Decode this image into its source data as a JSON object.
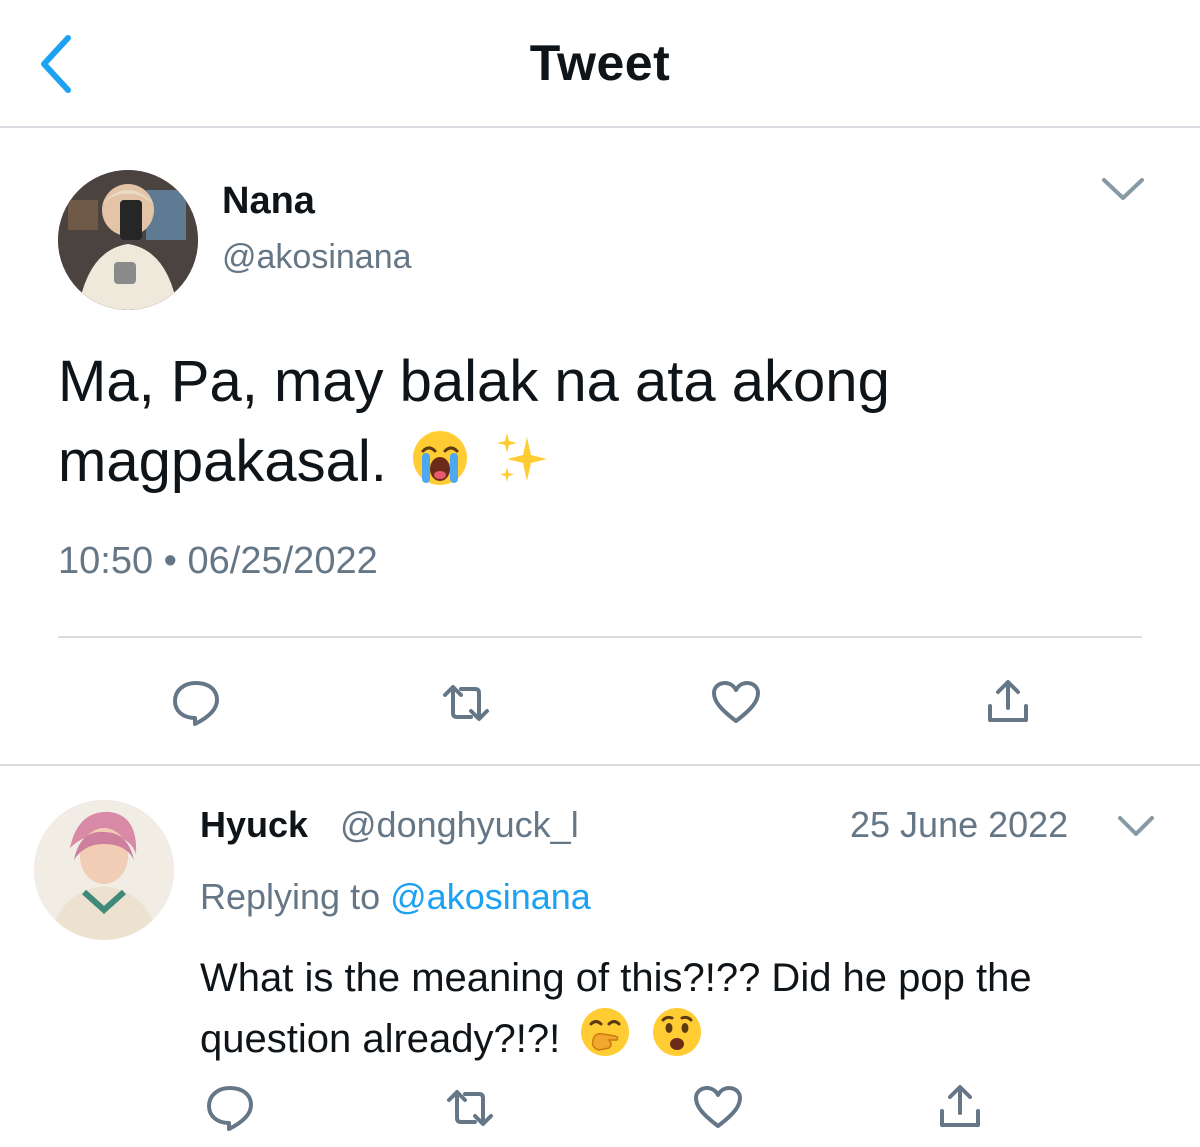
{
  "header": {
    "title": "Tweet",
    "back_icon": "chevron-left-icon",
    "accent_color": "#1da1f2"
  },
  "main_tweet": {
    "author_name": "Nana",
    "author_handle": "@akosinana",
    "text_line1": "Ma, Pa, may balak na ata akong",
    "text_line2": "magpakasal.",
    "emojis": [
      "loudly-crying-face-emoji",
      "sparkles-emoji"
    ],
    "time": "10:50",
    "separator": "•",
    "date": "06/25/2022",
    "actions": [
      "reply-icon",
      "retweet-icon",
      "like-icon",
      "share-icon"
    ]
  },
  "reply": {
    "author_name": "Hyuck",
    "author_handle": "@donghyuck_l",
    "date": "25 June 2022",
    "replying_prefix": "Replying to",
    "replying_handle": "@akosinana",
    "text": "What is the meaning of this?!?? Did he pop the question already?!?!",
    "emojis": [
      "face-with-hand-over-mouth-emoji",
      "anxious-face-emoji"
    ],
    "actions": [
      "reply-icon",
      "retweet-icon",
      "like-icon",
      "share-icon"
    ]
  },
  "colors": {
    "text": "#0f1419",
    "secondary": "#657786",
    "divider": "#d9dde1",
    "link": "#1da1f2"
  }
}
